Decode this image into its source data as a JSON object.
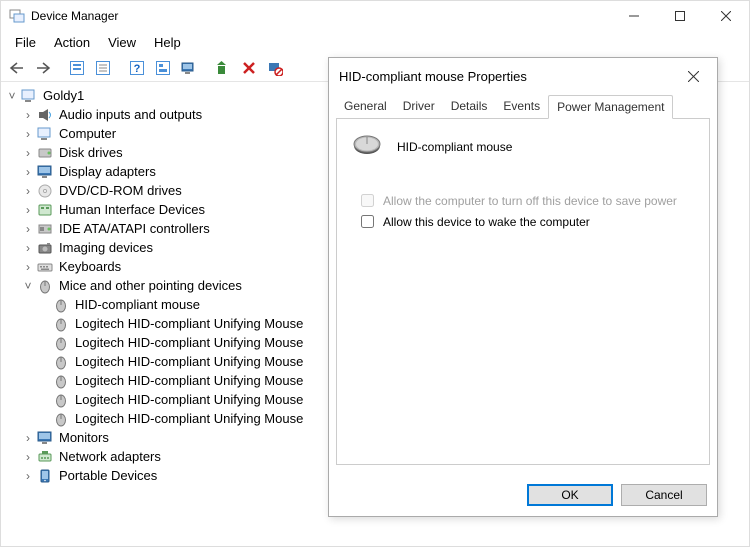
{
  "window": {
    "title": "Device Manager",
    "menu": [
      "File",
      "Action",
      "View",
      "Help"
    ]
  },
  "tree": {
    "root": "Goldy1",
    "nodes": [
      {
        "label": "Audio inputs and outputs",
        "icon": "audio"
      },
      {
        "label": "Computer",
        "icon": "computer"
      },
      {
        "label": "Disk drives",
        "icon": "disk"
      },
      {
        "label": "Display adapters",
        "icon": "display"
      },
      {
        "label": "DVD/CD-ROM drives",
        "icon": "dvd"
      },
      {
        "label": "Human Interface Devices",
        "icon": "hid"
      },
      {
        "label": "IDE ATA/ATAPI controllers",
        "icon": "ide"
      },
      {
        "label": "Imaging devices",
        "icon": "imaging"
      },
      {
        "label": "Keyboards",
        "icon": "keyboard"
      },
      {
        "label": "Mice and other pointing devices",
        "icon": "mouse",
        "expanded": true,
        "children": [
          "HID-compliant mouse",
          "Logitech HID-compliant Unifying Mouse",
          "Logitech HID-compliant Unifying Mouse",
          "Logitech HID-compliant Unifying Mouse",
          "Logitech HID-compliant Unifying Mouse",
          "Logitech HID-compliant Unifying Mouse",
          "Logitech HID-compliant Unifying Mouse"
        ]
      },
      {
        "label": "Monitors",
        "icon": "monitor"
      },
      {
        "label": "Network adapters",
        "icon": "network"
      },
      {
        "label": "Portable Devices",
        "icon": "portable"
      }
    ]
  },
  "dialog": {
    "title": "HID-compliant mouse Properties",
    "tabs": [
      "General",
      "Driver",
      "Details",
      "Events",
      "Power Management"
    ],
    "activeTab": "Power Management",
    "device_name": "HID-compliant mouse",
    "opt_save_power": "Allow the computer to turn off this device to save power",
    "opt_wake": "Allow this device to wake the computer",
    "ok": "OK",
    "cancel": "Cancel"
  }
}
